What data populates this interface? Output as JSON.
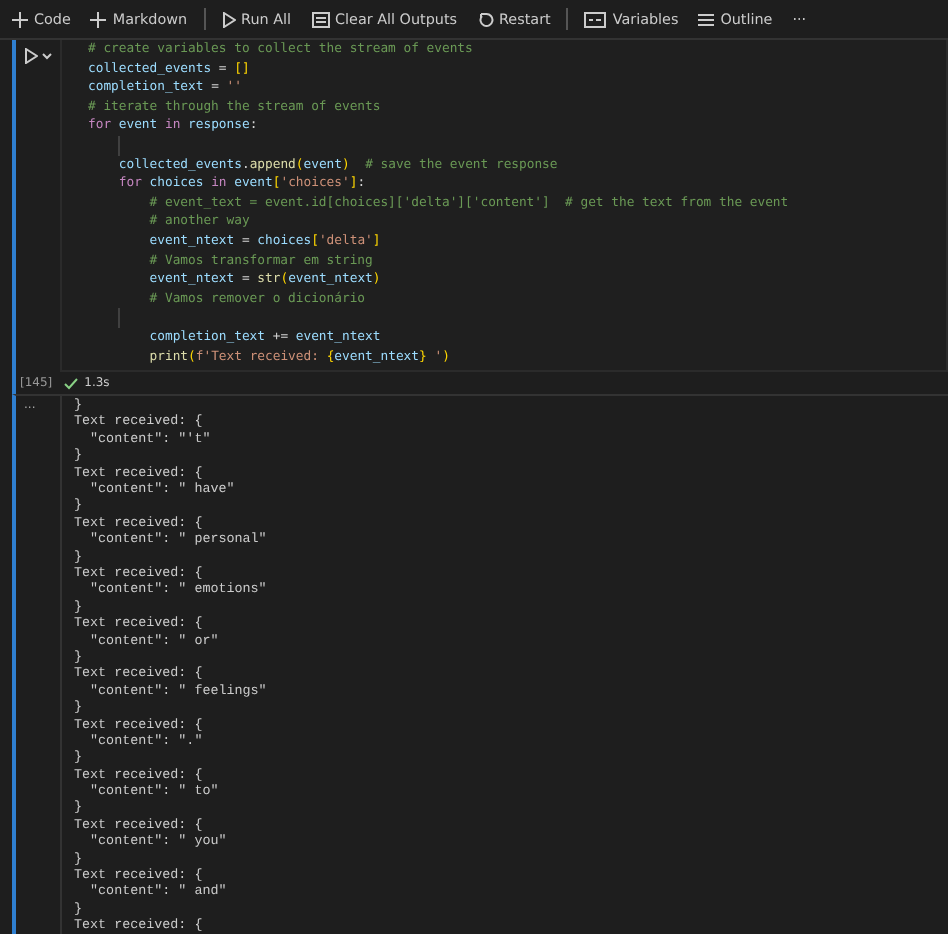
{
  "toolbar": {
    "items": [
      {
        "kind": "add",
        "label": "Code"
      },
      {
        "kind": "add",
        "label": "Markdown"
      },
      {
        "kind": "run",
        "label": "Run All"
      },
      {
        "kind": "clear",
        "label": "Clear All Outputs"
      },
      {
        "kind": "restart",
        "label": "Restart"
      },
      {
        "kind": "variables",
        "label": "Variables"
      },
      {
        "kind": "outline",
        "label": "Outline"
      },
      {
        "kind": "more",
        "label": "···"
      }
    ]
  },
  "code_cell": {
    "lines": [
      {
        "tokens": [
          {
            "kind": "comment",
            "text": "# create variables to collect the stream of events"
          }
        ]
      },
      {
        "tokens": [
          {
            "kind": "var",
            "text": "collected_events"
          },
          {
            "kind": "plain",
            "text": " = "
          },
          {
            "kind": "bracket",
            "text": "[]"
          }
        ]
      },
      {
        "tokens": [
          {
            "kind": "var",
            "text": "completion_text"
          },
          {
            "kind": "plain",
            "text": " = "
          },
          {
            "kind": "string",
            "text": "''"
          }
        ]
      },
      {
        "tokens": [
          {
            "kind": "comment",
            "text": "# iterate through the stream of events"
          }
        ]
      },
      {
        "tokens": [
          {
            "kind": "keyword",
            "text": "for"
          },
          {
            "kind": "var",
            "text": " event"
          },
          {
            "kind": "keyword",
            "text": " in "
          },
          {
            "kind": "var",
            "text": "response"
          },
          {
            "kind": "plain",
            "text": ":"
          }
        ]
      },
      {
        "kind": "blank"
      },
      {
        "tokens": [
          {
            "kind": "var",
            "text": "    collected_events"
          },
          {
            "kind": "plain",
            "text": "."
          },
          {
            "kind": "func",
            "text": "append"
          },
          {
            "kind": "bracket",
            "text": "("
          },
          {
            "kind": "var",
            "text": "event"
          },
          {
            "kind": "bracket",
            "text": ")"
          },
          {
            "kind": "comment",
            "text": "  # save the event response"
          }
        ]
      },
      {
        "tokens": [
          {
            "kind": "keyword",
            "text": "    for"
          },
          {
            "kind": "var",
            "text": " choices"
          },
          {
            "kind": "keyword",
            "text": " in "
          },
          {
            "kind": "var",
            "text": "event"
          },
          {
            "kind": "bracket",
            "text": "["
          },
          {
            "kind": "string",
            "text": "'choices'"
          },
          {
            "kind": "bracket",
            "text": "]"
          },
          {
            "kind": "plain",
            "text": ":"
          }
        ]
      },
      {
        "tokens": [
          {
            "kind": "comment",
            "text": "        # event_text = event.id[choices]['delta']['content']  # get the text from the event"
          }
        ]
      },
      {
        "tokens": [
          {
            "kind": "comment",
            "text": "        # another way"
          }
        ]
      },
      {
        "tokens": [
          {
            "kind": "var",
            "text": "        event_ntext"
          },
          {
            "kind": "plain",
            "text": " = "
          },
          {
            "kind": "var",
            "text": "choices"
          },
          {
            "kind": "bracket",
            "text": "["
          },
          {
            "kind": "string",
            "text": "'delta'"
          },
          {
            "kind": "bracket",
            "text": "]"
          }
        ]
      },
      {
        "tokens": [
          {
            "kind": "comment",
            "text": "        # Vamos transformar em string"
          }
        ]
      },
      {
        "tokens": [
          {
            "kind": "var",
            "text": "        event_ntext"
          },
          {
            "kind": "plain",
            "text": " = "
          },
          {
            "kind": "func",
            "text": "str"
          },
          {
            "kind": "bracket",
            "text": "("
          },
          {
            "kind": "var",
            "text": "event_ntext"
          },
          {
            "kind": "bracket",
            "text": ")"
          }
        ]
      },
      {
        "tokens": [
          {
            "kind": "comment",
            "text": "        # Vamos remover o dicionário"
          }
        ]
      },
      {
        "kind": "blank"
      },
      {
        "tokens": [
          {
            "kind": "var",
            "text": "        completion_text"
          },
          {
            "kind": "plain",
            "text": " += "
          },
          {
            "kind": "var",
            "text": "event_ntext"
          }
        ]
      },
      {
        "tokens": [
          {
            "kind": "func",
            "text": "        print"
          },
          {
            "kind": "bracket",
            "text": "("
          },
          {
            "kind": "string",
            "text": "f'Text received: "
          },
          {
            "kind": "bracket",
            "text": "{"
          },
          {
            "kind": "var",
            "text": "event_ntext"
          },
          {
            "kind": "bracket",
            "text": "}"
          },
          {
            "kind": "string",
            "text": " '"
          },
          {
            "kind": "bracket",
            "text": ")"
          }
        ]
      }
    ],
    "execution_count": "[145]",
    "succeeded": true,
    "duration": "1.3s"
  },
  "output": {
    "menu": "...",
    "lines": [
      "}",
      "Text received: {",
      "  \"content\": \"'t\"",
      "}",
      "Text received: {",
      "  \"content\": \" have\"",
      "}",
      "Text received: {",
      "  \"content\": \" personal\"",
      "}",
      "Text received: {",
      "  \"content\": \" emotions\"",
      "}",
      "Text received: {",
      "  \"content\": \" or\"",
      "}",
      "Text received: {",
      "  \"content\": \" feelings\"",
      "}",
      "Text received: {",
      "  \"content\": \".\"",
      "}",
      "Text received: {",
      "  \"content\": \" to\"",
      "}",
      "Text received: {",
      "  \"content\": \" you\"",
      "}",
      "Text received: {",
      "  \"content\": \" and\"",
      "}",
      "Text received: {"
    ]
  }
}
